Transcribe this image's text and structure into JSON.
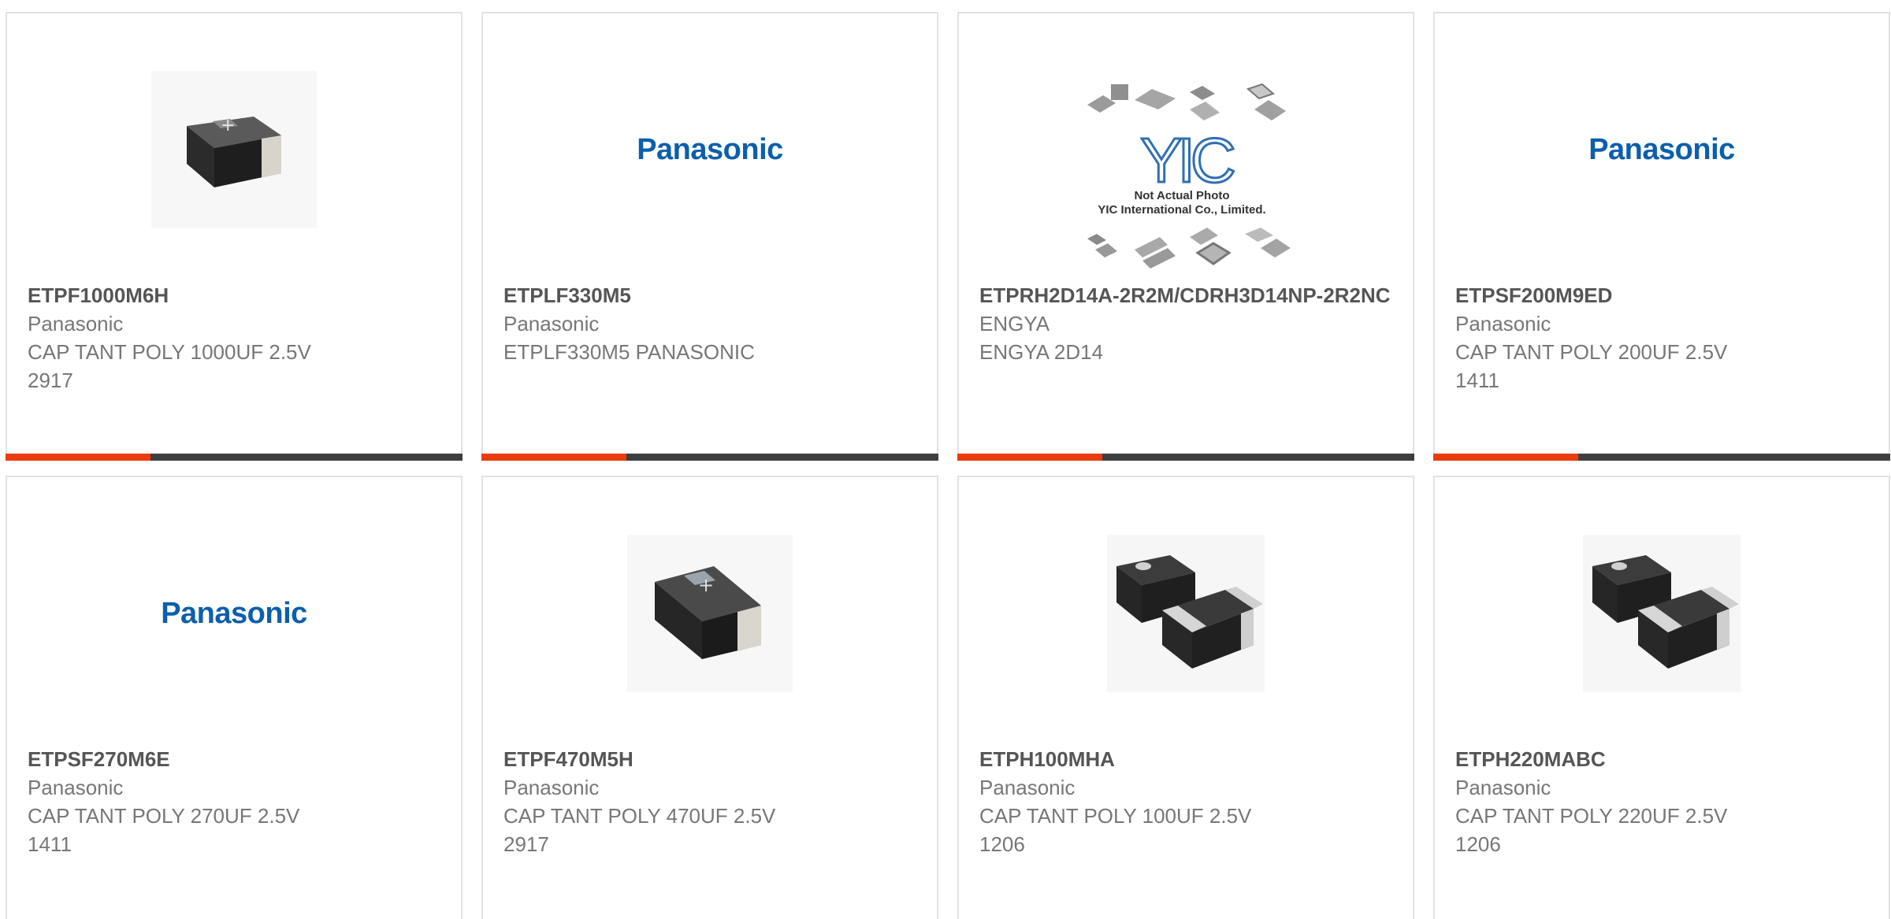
{
  "products": [
    {
      "part_number": "ETPF1000M6H",
      "manufacturer": "Panasonic",
      "desc1": "CAP TANT POLY 1000UF 2.5V",
      "desc2": "2917",
      "image": "tantalum-chip-image"
    },
    {
      "part_number": "ETPLF330M5",
      "manufacturer": "Panasonic",
      "desc1": "ETPLF330M5 PANASONIC",
      "desc2": "",
      "image": "panasonic-logo",
      "logo_text": "Panasonic"
    },
    {
      "part_number": "ETPRH2D14A-2R2M/CDRH3D14NP-2R2NC",
      "manufacturer": "ENGYA",
      "desc1": "ENGYA 2D14",
      "desc2": "",
      "image": "not-actual-photo-placeholder",
      "placeholder_logo": "YIC",
      "placeholder_line1": "Not Actual Photo",
      "placeholder_line2": "YIC International Co., Limited."
    },
    {
      "part_number": "ETPSF200M9ED",
      "manufacturer": "Panasonic",
      "desc1": "CAP TANT POLY 200UF 2.5V",
      "desc2": "1411",
      "image": "panasonic-logo",
      "logo_text": "Panasonic"
    },
    {
      "part_number": "ETPSF270M6E",
      "manufacturer": "Panasonic",
      "desc1": "CAP TANT POLY 270UF 2.5V",
      "desc2": "1411",
      "image": "panasonic-logo",
      "logo_text": "Panasonic"
    },
    {
      "part_number": "ETPF470M5H",
      "manufacturer": "Panasonic",
      "desc1": "CAP TANT POLY 470UF 2.5V",
      "desc2": "2917",
      "image": "tantalum-chip-image"
    },
    {
      "part_number": "ETPH100MHA",
      "manufacturer": "Panasonic",
      "desc1": "CAP TANT POLY 100UF 2.5V",
      "desc2": "1206",
      "image": "dual-chip-image"
    },
    {
      "part_number": "ETPH220MABC",
      "manufacturer": "Panasonic",
      "desc1": "CAP TANT POLY 220UF 2.5V",
      "desc2": "1206",
      "image": "dual-chip-image"
    }
  ],
  "colors": {
    "accent": "#ea3d0f",
    "bar": "#3f3f3f",
    "panasonic_blue": "#0b5fad",
    "text": "#777777",
    "part_number": "#555555"
  }
}
